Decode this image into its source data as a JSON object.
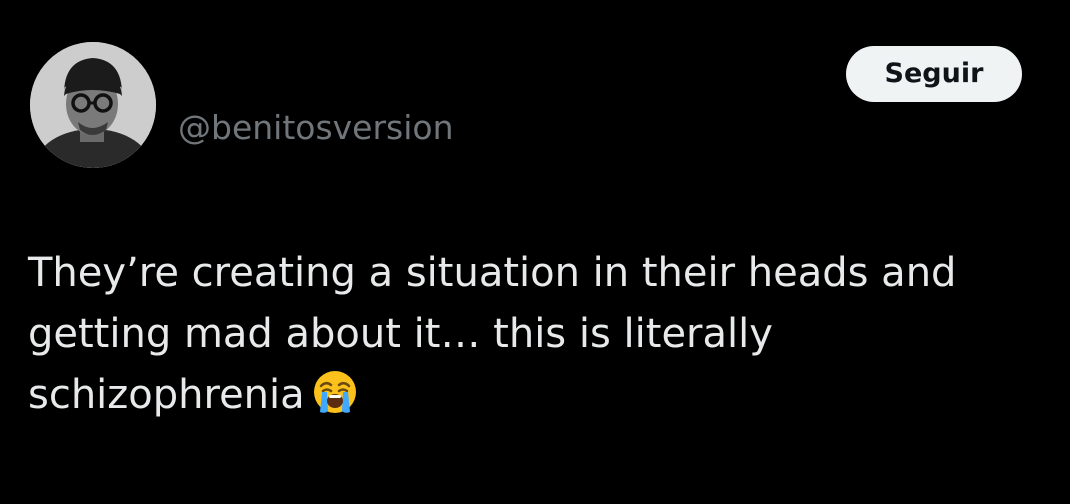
{
  "author": {
    "handle": "@benitosversion",
    "avatar_icon": "user-avatar-photo"
  },
  "follow_button": {
    "label": "Seguir"
  },
  "tweet": {
    "lines": [
      "They’re creating a situation in their heads and",
      "getting mad about it… this is literally",
      "schizophrenia"
    ],
    "emoji": "loudly-crying-face-icon"
  },
  "colors": {
    "background": "#000000",
    "text": "#e7e9ea",
    "secondary_text": "#71767b",
    "button_bg": "#eff3f4",
    "button_text": "#0f1419"
  }
}
